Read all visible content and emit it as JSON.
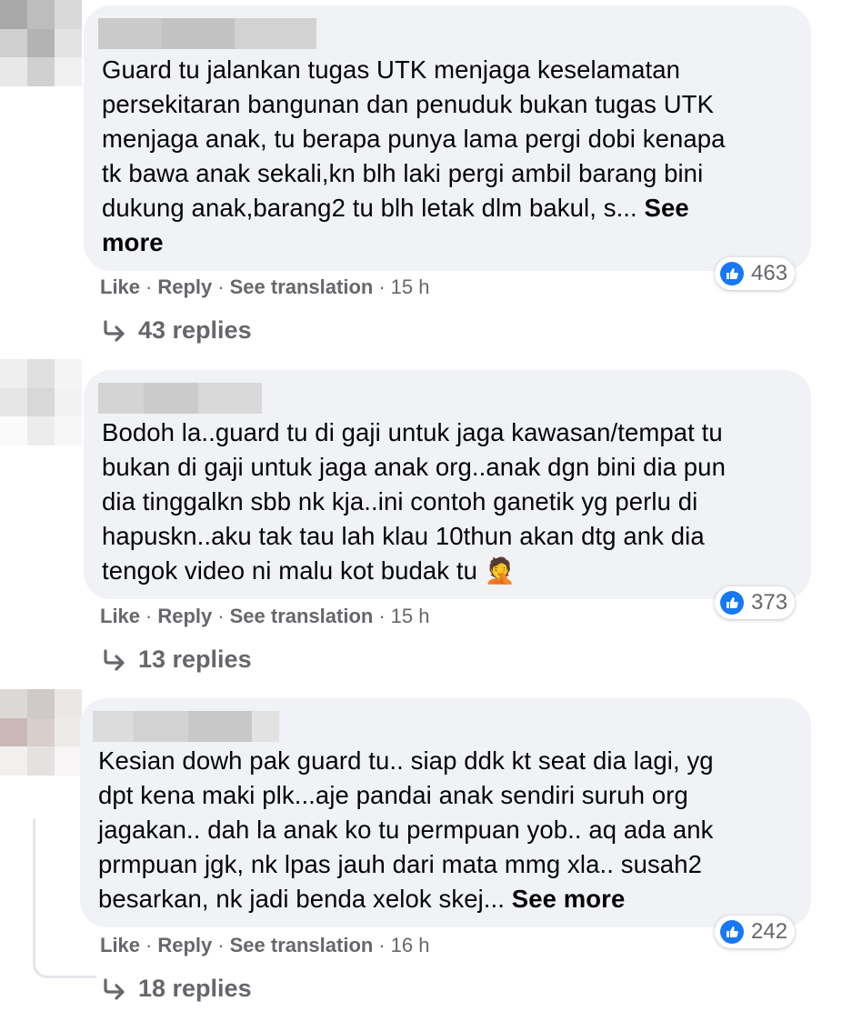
{
  "comments": [
    {
      "text": "Guard tu jalankan tugas UTK menjaga keselamatan\npersekitaran bangunan dan penuduk bukan tugas UTK\nmenjaga anak, tu berapa punya lama pergi dobi kenapa\ntk bawa anak sekali,kn blh laki pergi ambil barang bini\ndukung anak,barang2 tu blh letak dlm bakul, s... ",
      "see_more": "See\nmore",
      "like_count": "463",
      "actions": {
        "like": "Like",
        "reply": "Reply",
        "translate": "See translation",
        "time": "15 h"
      },
      "replies": "43 replies"
    },
    {
      "text": "Bodoh la..guard tu di gaji untuk jaga kawasan/tempat tu\nbukan di gaji untuk jaga anak org..anak dgn bini dia pun\ndia tinggalkn sbb nk kja..ini contoh ganetik yg perlu di\nhapuskn..aku tak tau lah klau 10thun akan dtg ank dia\ntengok video ni malu kot budak tu ",
      "emoji": "🤦",
      "like_count": "373",
      "actions": {
        "like": "Like",
        "reply": "Reply",
        "translate": "See translation",
        "time": "15 h"
      },
      "replies": "13 replies"
    },
    {
      "text": "Kesian dowh pak guard tu.. siap ddk kt seat dia lagi, yg\ndpt kena maki plk...aje pandai anak sendiri suruh org\njagakan.. dah la anak ko tu permpuan yob.. aq ada ank\nprmpuan jgk, nk lpas jauh dari mata mmg xla.. susah2\nbesarkan, nk jadi benda xelok skej... ",
      "see_more": "See more",
      "like_count": "242",
      "actions": {
        "like": "Like",
        "reply": "Reply",
        "translate": "See translation",
        "time": "16 h"
      },
      "replies": "18 replies"
    }
  ],
  "separator": "·",
  "colors": {
    "bubble": "#f0f2f5",
    "meta": "#65676b",
    "like_blue": "#1877f2"
  }
}
